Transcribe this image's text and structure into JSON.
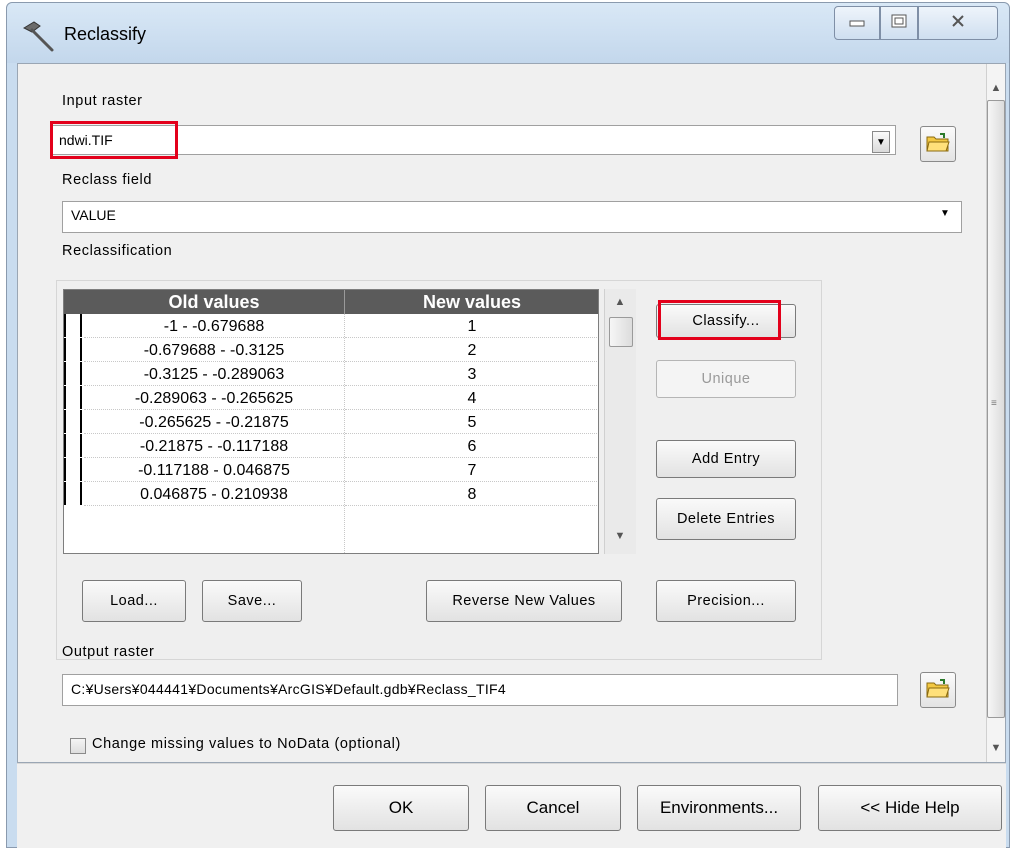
{
  "window": {
    "title": "Reclassify"
  },
  "input_raster": {
    "label": "Input raster",
    "value": "ndwi.TIF"
  },
  "reclass_field": {
    "label": "Reclass field",
    "value": "VALUE"
  },
  "reclassification": {
    "label": "Reclassification",
    "columns": [
      "Old values",
      "New values"
    ],
    "rows": [
      {
        "old": "-1 - -0.679688",
        "new": "1"
      },
      {
        "old": "-0.679688 - -0.3125",
        "new": "2"
      },
      {
        "old": "-0.3125 - -0.289063",
        "new": "3"
      },
      {
        "old": "-0.289063 - -0.265625",
        "new": "4"
      },
      {
        "old": "-0.265625 - -0.21875",
        "new": "5"
      },
      {
        "old": "-0.21875 - -0.117188",
        "new": "6"
      },
      {
        "old": "-0.117188 - 0.046875",
        "new": "7"
      },
      {
        "old": "0.046875 - 0.210938",
        "new": "8"
      }
    ],
    "buttons": {
      "classify": "Classify...",
      "unique": "Unique",
      "add_entry": "Add Entry",
      "delete_entries": "Delete Entries",
      "load": "Load...",
      "save": "Save...",
      "reverse": "Reverse New Values",
      "precision": "Precision..."
    }
  },
  "output_raster": {
    "label": "Output raster",
    "value": "C:¥Users¥044441¥Documents¥ArcGIS¥Default.gdb¥Reclass_TIF4"
  },
  "nodata_option": {
    "label": "Change missing values to NoData (optional)",
    "checked": false
  },
  "footer": {
    "ok": "OK",
    "cancel": "Cancel",
    "environments": "Environments...",
    "hide_help": "<< Hide Help"
  },
  "colors": {
    "highlight": "#e3001b",
    "header": "#5b5b5b"
  }
}
